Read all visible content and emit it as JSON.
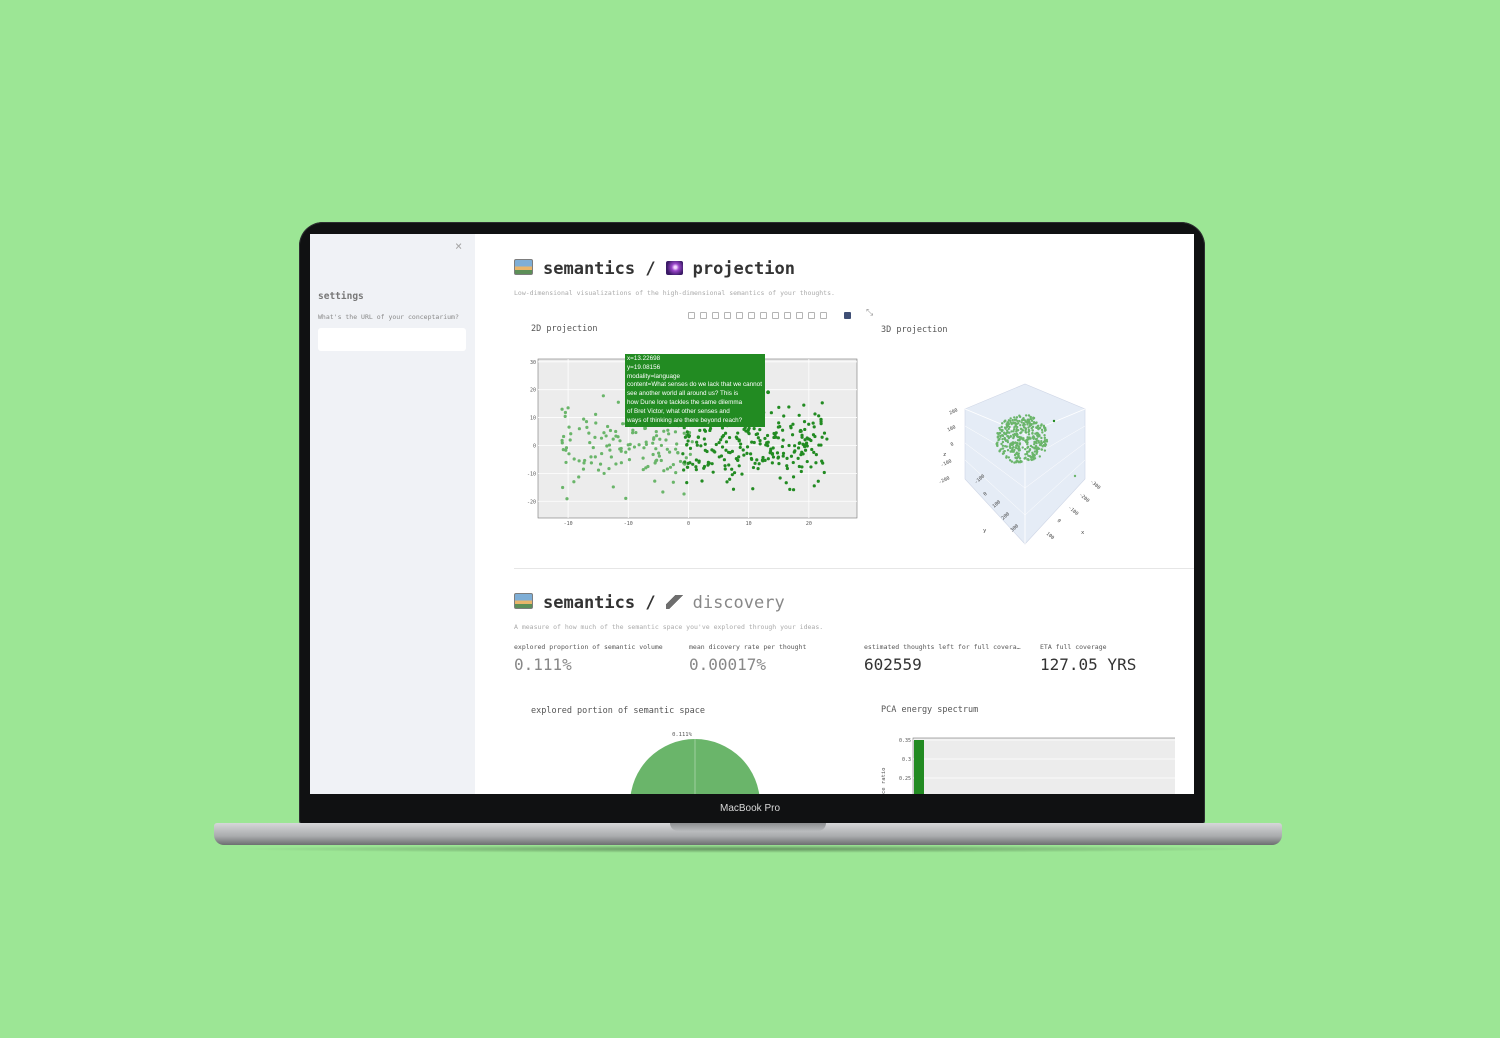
{
  "device": {
    "brand_label": "MacBook Pro"
  },
  "sidebar": {
    "close_glyph": "×",
    "title": "settings",
    "url_label": "What's the URL of your conceptarium?",
    "url_value": ""
  },
  "projection_section": {
    "title_part1": "semantics /",
    "title_part2": "projection",
    "subtitle": "Low-dimensional visualizations of the high-dimensional semantics of your thoughts.",
    "plot2d_label": "2D projection",
    "plot3d_label": "3D projection",
    "tooltip_lines": [
      "x=13.22698",
      "y=19.08156",
      "modality=language",
      "content=What senses do we lack that we cannot",
      "see another world all around us? This is",
      "how Dune lore tackles the same dilemma",
      "of Bret Victor, what other senses and",
      "ways of thinking are there beyond reach?"
    ],
    "modebar_icons": [
      "camera-icon",
      "zoom-icon",
      "pan-icon",
      "box-select-icon",
      "lasso-icon",
      "zoom-in-icon",
      "zoom-out-icon",
      "autoscale-icon",
      "home-icon",
      "spike-icon",
      "hover-closest-icon",
      "hover-compare-icon",
      "plotly-logo-icon"
    ]
  },
  "discovery_section": {
    "title_part1": "semantics /",
    "title_part2": "discovery",
    "subtitle": "A measure of how much of the semantic space you've explored through your ideas.",
    "metrics": [
      {
        "label": "explored proportion of semantic volume",
        "value": "0.111%"
      },
      {
        "label": "mean dicovery rate per thought",
        "value": "0.00017%"
      },
      {
        "label": "estimated thoughts left for full covera…",
        "value": "602559"
      },
      {
        "label": "ETA full coverage",
        "value": "127.05 YRS"
      }
    ],
    "pie_label": "explored portion of semantic space",
    "pca_label": "PCA energy spectrum"
  },
  "chart_data": [
    {
      "type": "scatter",
      "title": "2D projection",
      "xticks": [
        "-10",
        "-10",
        "0",
        "10",
        "20"
      ],
      "yticks": [
        "30",
        "20",
        "10",
        "0",
        "-10",
        "-20"
      ],
      "xlim": [
        -25,
        28
      ],
      "ylim": [
        -26,
        31
      ],
      "series": [
        {
          "name": "",
          "color": "#6ab56a",
          "values_note": "lighter points, x in [-22, 0]"
        },
        {
          "name": "",
          "color": "#228b22",
          "values_note": "darker points, x in [-2, 25]"
        }
      ],
      "hovered_point": {
        "x": 13.22698,
        "y": 19.08156
      }
    },
    {
      "type": "scatter",
      "title": "3D projection",
      "z_ticks": [
        "200",
        "100",
        "0",
        "-100",
        "-200"
      ],
      "y_ticks": [
        "-300",
        "-200",
        "-100",
        "0",
        "100",
        "200",
        "300"
      ],
      "x_ticks": [
        "-300",
        "-200",
        "-100",
        "0",
        "100"
      ],
      "axis_labels": {
        "x": "x",
        "y": "y",
        "z": "z"
      }
    },
    {
      "type": "pie",
      "title": "explored portion of semantic space",
      "labels": [
        "0.111%"
      ],
      "values": [
        0.111,
        99.889
      ],
      "color": "#6ab56a"
    },
    {
      "type": "bar",
      "title": "PCA energy spectrum",
      "yticks": [
        "0.35",
        "0.3",
        "0.25"
      ],
      "ylabel": "ce ratio",
      "values": [
        0.35
      ],
      "color": "#228b22"
    }
  ]
}
